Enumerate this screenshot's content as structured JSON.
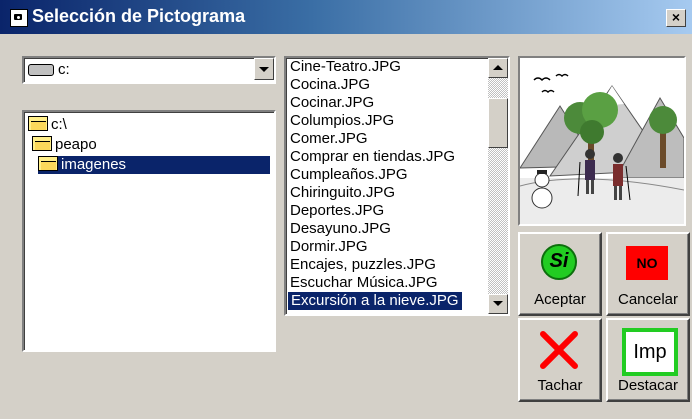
{
  "window": {
    "title": "Selección de Pictograma",
    "close_glyph": "×"
  },
  "drive": {
    "value": "c:",
    "icon": "drive-icon"
  },
  "tree": {
    "items": [
      {
        "label": "c:\\",
        "icon": "open-folder-icon",
        "selected": false
      },
      {
        "label": "peapo",
        "icon": "open-folder-icon",
        "selected": false
      },
      {
        "label": "imagenes",
        "icon": "open-folder-icon",
        "selected": true
      }
    ]
  },
  "files": {
    "items": [
      "Cine-Teatro.JPG",
      "Cocina.JPG",
      "Cocinar.JPG",
      "Columpios.JPG",
      "Comer.JPG",
      "Comprar en tiendas.JPG",
      "Cumpleaños.JPG",
      "Chiringuito.JPG",
      "Deportes.JPG",
      "Desayuno.JPG",
      "Dormir.JPG",
      "Encajes, puzzles.JPG",
      "Escuchar Música.JPG",
      "Excursión a la nieve.JPG"
    ],
    "selected": "Excursión a la nieve.JPG"
  },
  "buttons": {
    "accept": {
      "label": "Aceptar",
      "icon_text": "Si"
    },
    "cancel": {
      "label": "Cancelar",
      "icon_text": "NO"
    },
    "strike": {
      "label": "Tachar"
    },
    "highlight": {
      "label": "Destacar",
      "icon_text": "Imp"
    }
  },
  "colors": {
    "title_bar": "#0a246a",
    "selection": "#0a246a",
    "accept_green": "#22cc22",
    "cancel_red": "#ff0000",
    "strike_red": "#ff0000"
  }
}
